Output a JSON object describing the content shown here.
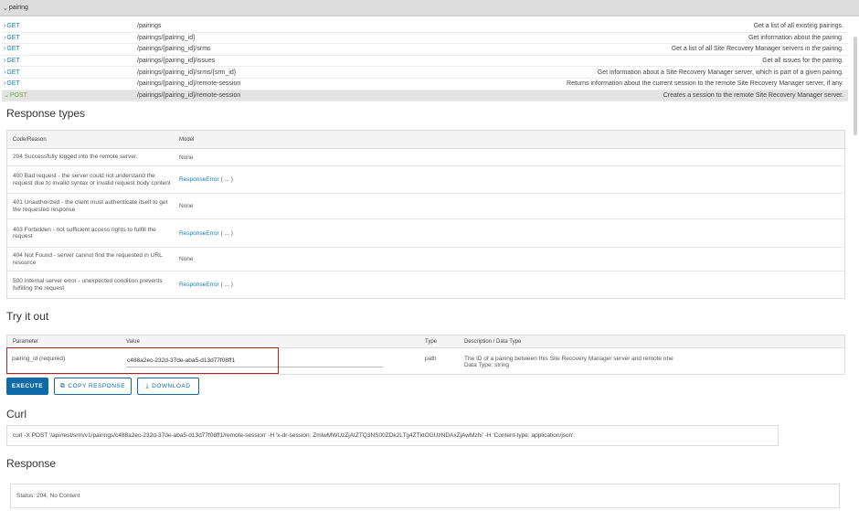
{
  "section": {
    "label": "pairing"
  },
  "endpoints": [
    {
      "method": "GET",
      "path": "/pairings",
      "description": "Get a list of all existing pairings."
    },
    {
      "method": "GET",
      "path": "/pairings/{pairing_id}",
      "description": "Get information about the pairing."
    },
    {
      "method": "GET",
      "path": "/pairings/{pairing_id}/srms",
      "description": "Get a list of all Site Recovery Manager servers in the pairing."
    },
    {
      "method": "GET",
      "path": "/pairings/{pairing_id}/issues",
      "description": "Get all issues for the pairing."
    },
    {
      "method": "GET",
      "path": "/pairings/{pairing_id}/srms/{srm_id}",
      "description": "Get information about a Site Recovery Manager server, which is part of a given pairing."
    },
    {
      "method": "GET",
      "path": "/pairings/{pairing_id}/remote-session",
      "description": "Returns information about the current session to the remote Site Recovery Manager server, if any."
    },
    {
      "method": "POST",
      "path": "/pairings/{pairing_id}/remote-session",
      "description": "Creates a session to the remote Site Recovery Manager server."
    }
  ],
  "response_types": {
    "title": "Response types",
    "col_code": "Code/Reason",
    "col_model": "Model",
    "rows": [
      {
        "code": "204 Successfully logged into the remote server.",
        "model_link": "",
        "model_text": "None"
      },
      {
        "code": "400 Bad request - the server could not understand the request due to invalid syntax or invalid request body content",
        "model_link": "ResponseError",
        "model_text": " ( ... )"
      },
      {
        "code": "401 Unauthorized - the client must authenticate itself to get the requested response",
        "model_link": "",
        "model_text": "None"
      },
      {
        "code": "403 Forbidden - not sufficient access rights to fulfill the request",
        "model_link": "ResponseError",
        "model_text": " ( ... )"
      },
      {
        "code": "404 Not Found - server cannot find the requested in URL resource",
        "model_link": "",
        "model_text": "None"
      },
      {
        "code": "500 Internal server error - unexpected condition prevents fulfilling the request",
        "model_link": "ResponseError",
        "model_text": " ( ... )"
      }
    ]
  },
  "try_it_out": {
    "title": "Try it out",
    "col_parameter": "Parameter",
    "col_value": "Value",
    "col_type": "Type",
    "col_description": "Description / Data Type",
    "param_name": "pairing_id (required)",
    "param_value": "c488a2ec-232d-37de-aba5-d13d77f08ff1",
    "param_type": "path",
    "param_description": "The ID of a pairing between this Site Recovery Manager server and remote one",
    "param_datatype": "Data Type: string"
  },
  "buttons": {
    "execute": "EXECUTE",
    "copy_response": "COPY RESPONSE",
    "download": "DOWNLOAD"
  },
  "curl": {
    "title": "Curl",
    "command": "curl -X POST '/api/rest/srm/v1/pairings/c488a2ec-232d-37de-aba5-d13d77f08ff1/remote-session' -H 'x-dr-session: ZmlwMWUzZjAtZTQ3NS00ZDk2LTg4ZTktOGUzNDAxZjAwMzhi' -H 'Content-type: application/json'"
  },
  "response": {
    "title": "Response",
    "status": "Status: 204, No Content"
  },
  "colors": {
    "get": "#1a7fbf",
    "post": "#6da83a",
    "execute_bg": "#0e6aa8",
    "highlight": "#b22222"
  }
}
